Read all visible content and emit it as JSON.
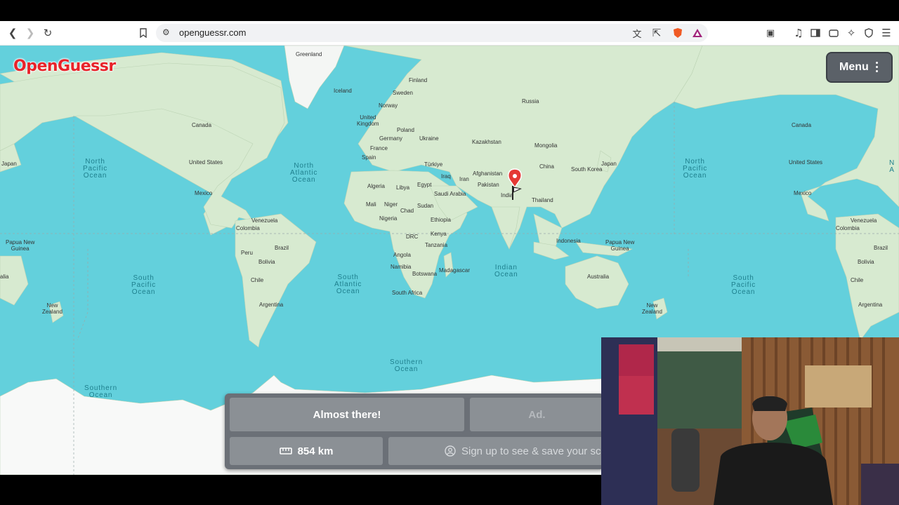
{
  "browser": {
    "url": "openguessr.com",
    "icons": [
      "back-icon",
      "forward-icon",
      "reload-icon",
      "bookmark-icon",
      "site-settings-icon",
      "translate-icon",
      "share-icon",
      "brave-shield-icon",
      "brave-rewards-icon",
      "reader-icon",
      "media-icon",
      "sidebar-icon",
      "wallet-icon",
      "leo-icon",
      "vpn-icon",
      "menu-icon"
    ]
  },
  "app": {
    "logo": "OpenGuessr",
    "menu_label": "Menu"
  },
  "result": {
    "message": "Almost there!",
    "ad_label": "Ad.",
    "distance": "854 km",
    "signup": "Sign up to see & save your score"
  },
  "map_labels": {
    "greenland": "Greenland",
    "iceland": "Iceland",
    "finland": "Finland",
    "sweden": "Sweden",
    "norway": "Norway",
    "russia": "Russia",
    "uk": "United\nKingdom",
    "poland": "Poland",
    "germany": "Germany",
    "ukraine": "Ukraine",
    "france": "France",
    "spain": "Spain",
    "kazakhstan": "Kazakhstan",
    "mongolia": "Mongolia",
    "turkiye": "Türkiye",
    "china": "China",
    "south_korea": "South Korea",
    "japan_r": "Japan",
    "japan_l": "Japan",
    "iraq": "Iraq",
    "afghanistan": "Afghanistan",
    "iran": "Iran",
    "pakistan": "Pakistan",
    "india": "India",
    "algeria": "Algeria",
    "libya": "Libya",
    "egypt": "Egypt",
    "saudi": "Saudi Arabia",
    "thailand": "Thailand",
    "mali": "Mali",
    "niger": "Niger",
    "chad": "Chad",
    "sudan": "Sudan",
    "nigeria": "Nigeria",
    "ethiopia": "Ethiopia",
    "drc": "DRC",
    "kenya": "Kenya",
    "tanzania": "Tanzania",
    "angola": "Angola",
    "namibia": "Namibia",
    "botswana": "Botswana",
    "madagascar": "Madagascar",
    "south_africa": "South Africa",
    "indonesia": "Indonesia",
    "png_r": "Papua New\nGuinea",
    "png_l": "Papua New\nGuinea",
    "australia": "Australia",
    "nz_r": "New\nZealand",
    "nz_l": "New\nZealand",
    "canada_l": "Canada",
    "canada_r": "Canada",
    "us_l": "United States",
    "us_r": "United States",
    "mexico_l": "Mexico",
    "mexico_r": "Mexico",
    "venezuela_l": "Venezuela",
    "venezuela_r": "Venezuela",
    "colombia_l": "Colombia",
    "colombia_r": "Colombia",
    "peru": "Peru",
    "brazil_l": "Brazil",
    "brazil_r": "Brazil",
    "bolivia_l": "Bolivia",
    "bolivia_r": "Bolivia",
    "chile_l": "Chile",
    "chile_r": "Chile",
    "argentina_l": "Argentina",
    "argentina_r": "Argentina",
    "alia": "alia"
  },
  "oceans": {
    "north_pacific_l": "North\nPacific\nOcean",
    "north_pacific_r": "North\nPacific\nOcean",
    "north_atlantic": "North\nAtlantic\nOcean",
    "south_pacific_l": "South\nPacific\nOcean",
    "south_pacific_r": "South\nPacific\nOcean",
    "south_atlantic": "South\nAtlantic\nOcean",
    "indian": "Indian\nOcean",
    "southern_l": "Southern\nOcean",
    "southern_m": "Southern\nOcean",
    "north_atlantic_r_edge": "N\nA"
  },
  "colors": {
    "ocean": "#63d0dc",
    "land": "#d7ead0",
    "logo": "#e8232a",
    "panel": "#6b7077",
    "marker": "#e53935"
  }
}
